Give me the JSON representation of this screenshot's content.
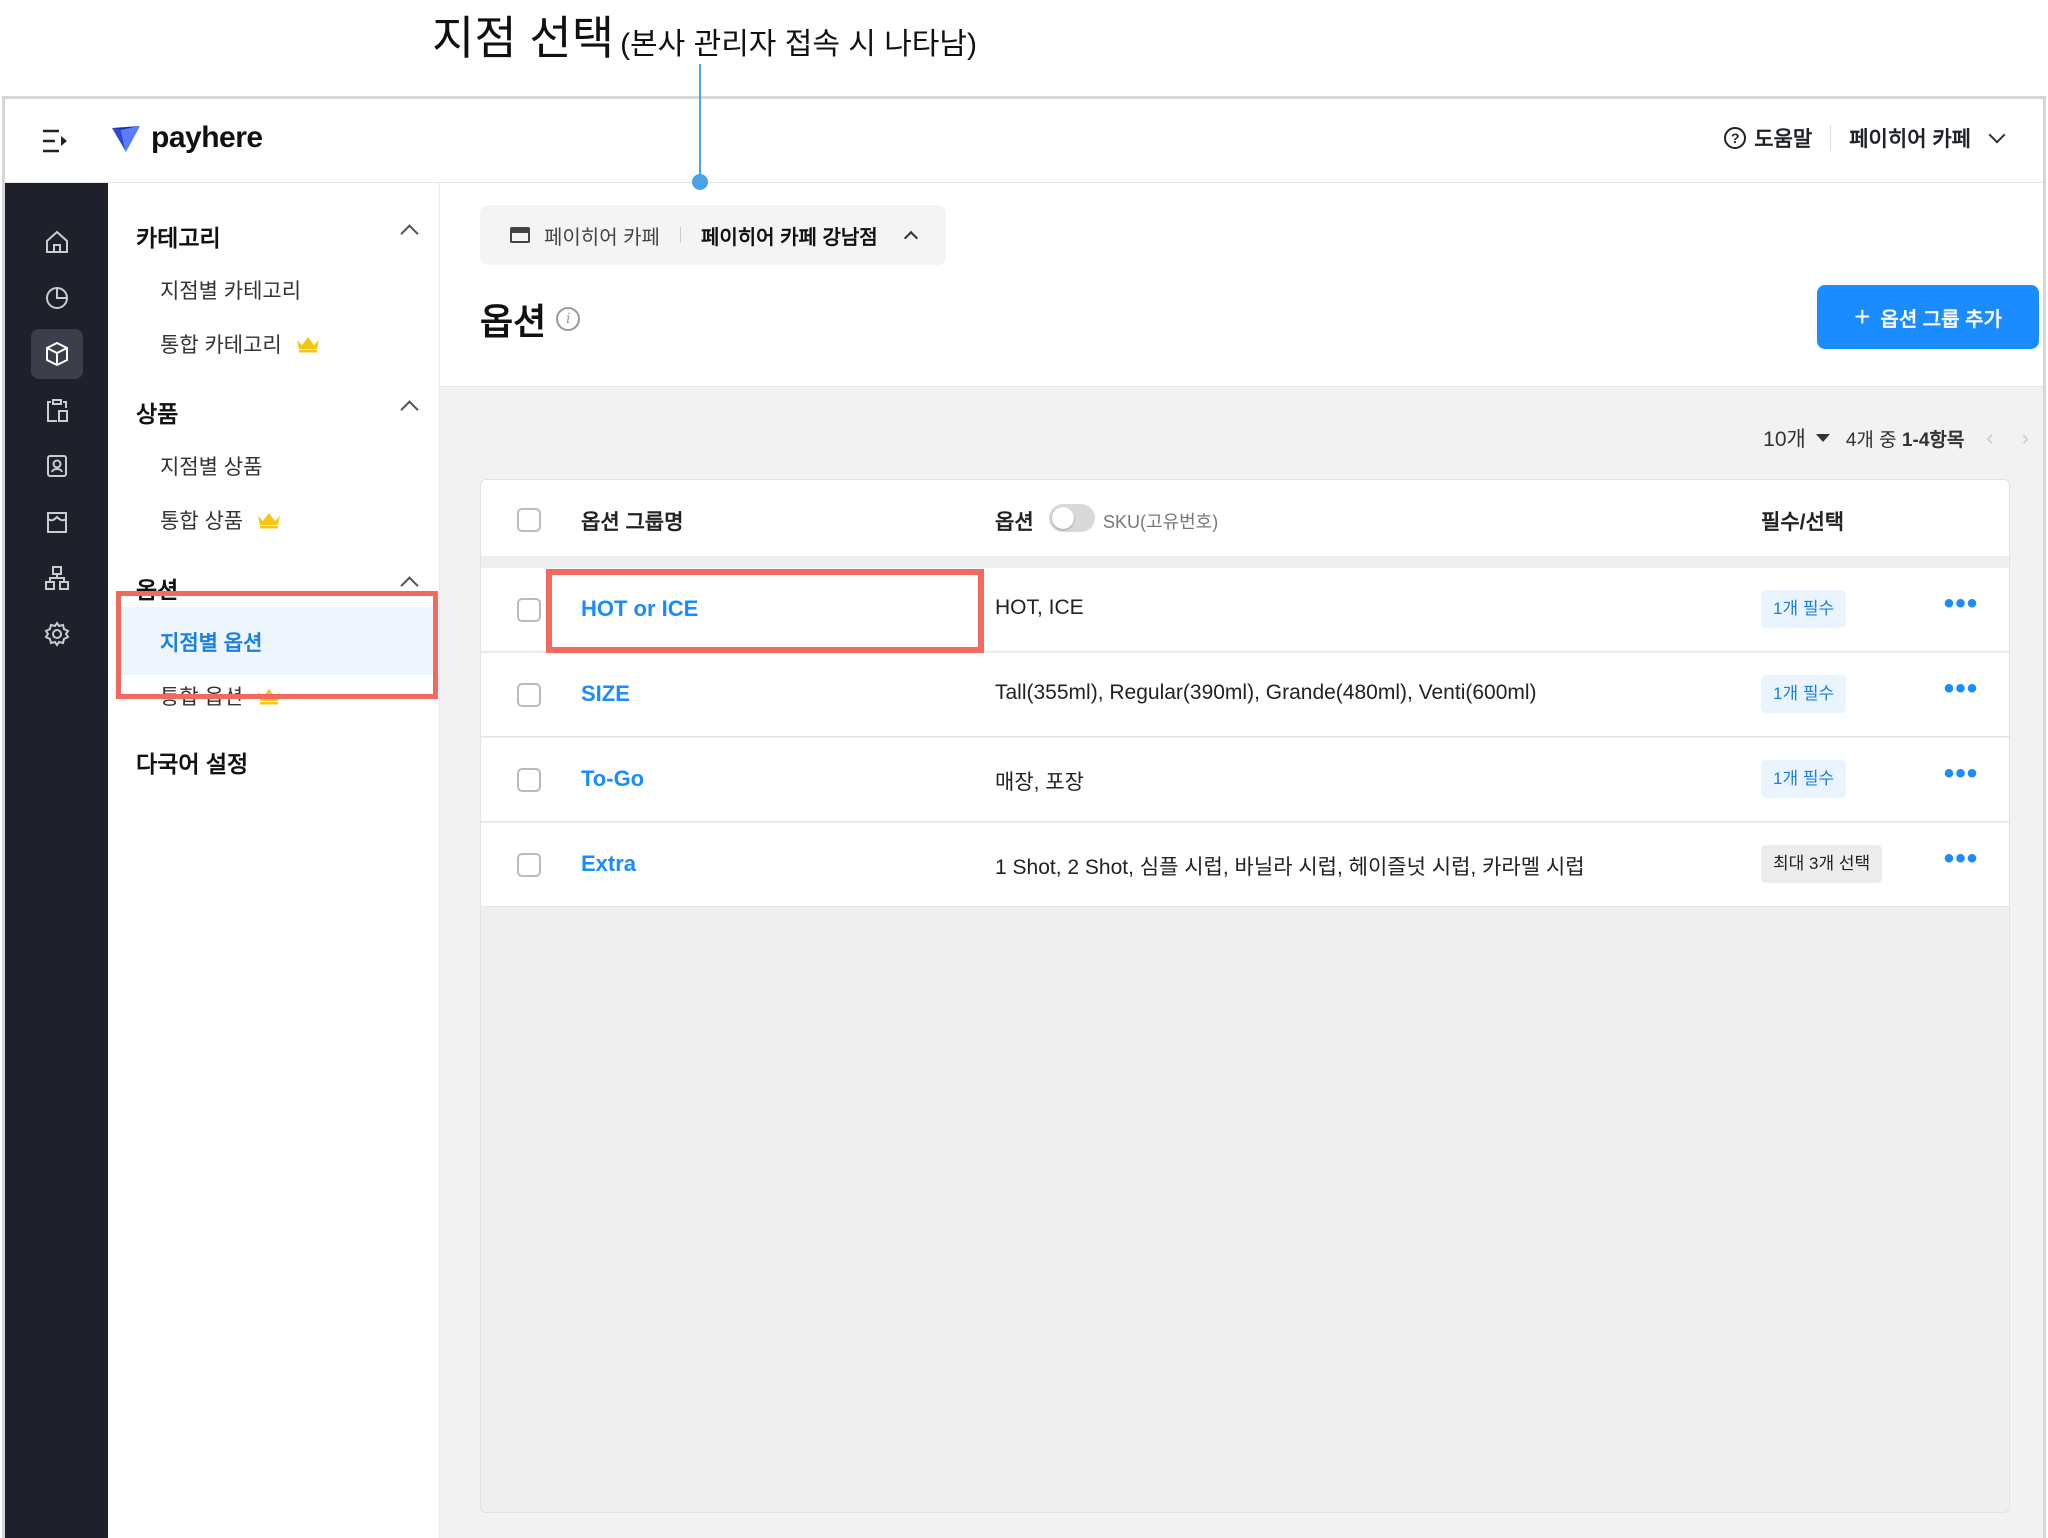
{
  "callout": {
    "title": "지점 선택",
    "subtitle": "(본사 관리자 접속 시 나타남)"
  },
  "header": {
    "logo_text": "payhere",
    "help_label": "도움말",
    "store_name": "페이히어 카페"
  },
  "rail": {
    "icons": [
      "home-icon",
      "pie-chart-icon",
      "box-icon",
      "clipboard-icon",
      "contact-icon",
      "store-icon",
      "org-chart-icon",
      "gear-icon"
    ],
    "active": "box-icon"
  },
  "sidebar": {
    "sections": [
      {
        "title": "카테고리",
        "items": [
          {
            "label": "지점별 카테고리"
          },
          {
            "label": "통합 카테고리",
            "premium": true
          }
        ]
      },
      {
        "title": "상품",
        "items": [
          {
            "label": "지점별 상품"
          },
          {
            "label": "통합 상품",
            "premium": true
          }
        ]
      },
      {
        "title": "옵션",
        "items": [
          {
            "label": "지점별 옵션",
            "active": true
          },
          {
            "label": "통합 옵션",
            "premium": true
          }
        ]
      }
    ],
    "footer_item": "다국어 설정"
  },
  "branch": {
    "company": "페이히어 카페",
    "selected": "페이히어 카페 강남점"
  },
  "page": {
    "title": "옵션",
    "add_button": "옵션 그룹 추가"
  },
  "pager": {
    "per_page": "10개",
    "range_prefix": "4개 중",
    "range": "1-4항목"
  },
  "table": {
    "headers": {
      "name": "옵션 그룹명",
      "options": "옵션",
      "sku_toggle": "SKU(고유번호)",
      "required": "필수/선택"
    },
    "sku_toggle_on": false,
    "rows": [
      {
        "name": "HOT or ICE",
        "options": "HOT, ICE",
        "rule": "1개 필수"
      },
      {
        "name": "SIZE",
        "options": "Tall(355ml), Regular(390ml), Grande(480ml), Venti(600ml)",
        "rule": "1개 필수"
      },
      {
        "name": "To-Go",
        "options": "매장, 포장",
        "rule": "1개 필수"
      },
      {
        "name": "Extra",
        "options": "1 Shot, 2 Shot, 심플 시럽, 바닐라 시럽, 헤이즐넛 시럽, 카라멜 시럽",
        "rule": "최대 3개 선택"
      }
    ]
  },
  "colors": {
    "accent": "#1a8cff",
    "highlight": "#f26a5d",
    "rail_bg": "#1e2129",
    "crown": "#f5c518"
  }
}
